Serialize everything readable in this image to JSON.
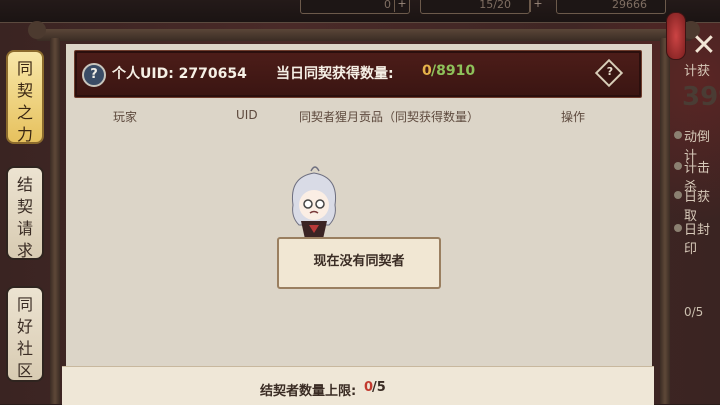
{
  "top_bar": {
    "counters": [
      "0",
      "15/20",
      "29666"
    ]
  },
  "header": {
    "help_icon_glyph": "?",
    "uid_text": "个人UID: 2770654",
    "daily_label": "当日同契获得数量:",
    "daily_current": "0",
    "daily_max": "/8910",
    "info_icon_glyph": "?"
  },
  "columns": [
    "玩家",
    "UID",
    "同契者猩月贡品（同契获得数量）",
    "操作"
  ],
  "empty_message": "现在没有同契者",
  "bottom": {
    "cap_label": "结契者数量上限:",
    "cap_current": "0",
    "cap_max": "/5"
  },
  "tabs": [
    {
      "label": "同\n契\n之\n力",
      "active": true
    },
    {
      "label": "结\n契\n请\n求",
      "active": false
    },
    {
      "label": "同\n好\n社\n区",
      "active": false
    }
  ],
  "right_panel": {
    "lines": [
      "计获",
      "动倒计",
      "计击杀",
      "日获取",
      "日封印"
    ],
    "big_number": "399",
    "count": "0/5"
  },
  "close_glyph": "✕",
  "colors": {
    "accent_gold": "#e6b24a",
    "accent_green": "#8ec15a",
    "cap_red": "#c23a2e",
    "header_bg": "#4d1d19"
  }
}
